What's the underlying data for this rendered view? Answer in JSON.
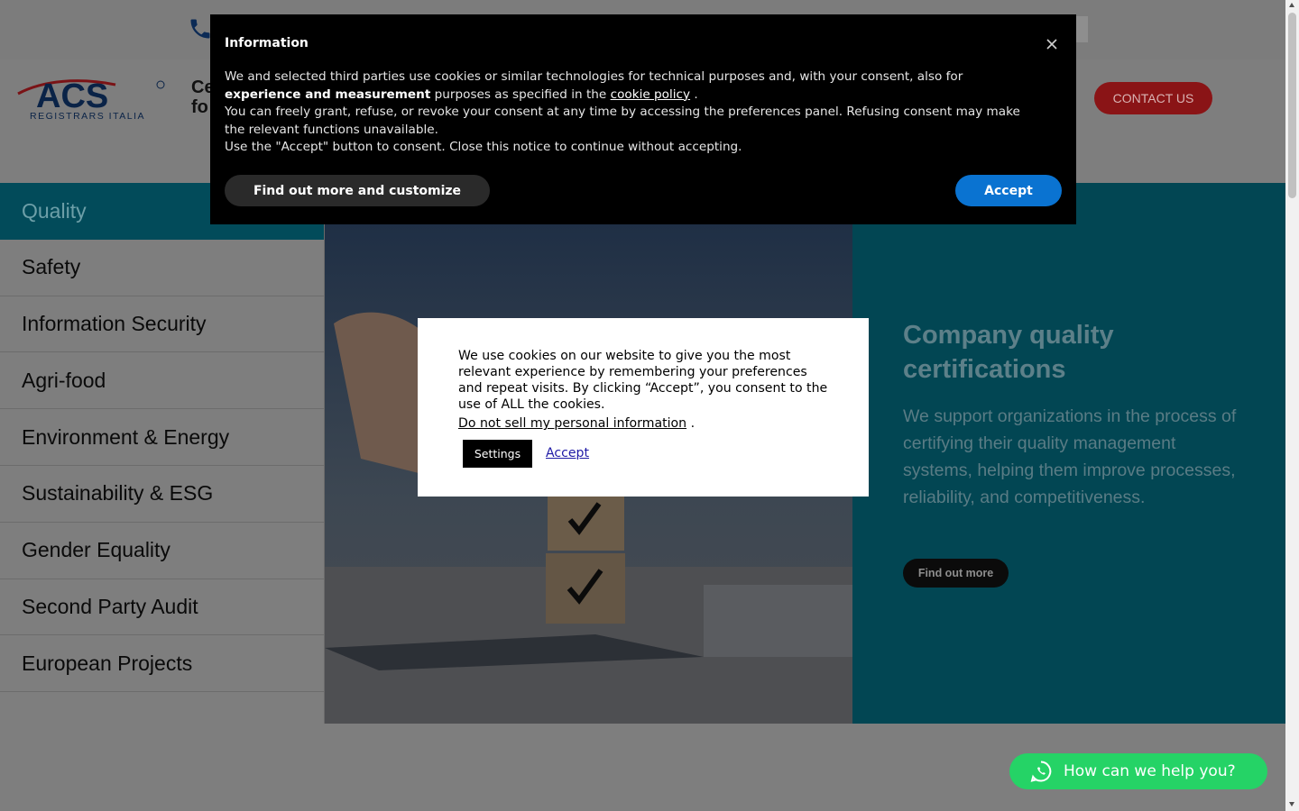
{
  "header": {
    "logo_text": "ACS",
    "logo_subtext": "REGISTRARS ITALIA",
    "tagline": "Ce fo",
    "contact_label": "CONTACT US"
  },
  "sidebar": {
    "items": [
      {
        "label": "Quality",
        "active": true
      },
      {
        "label": "Safety"
      },
      {
        "label": "Information Security"
      },
      {
        "label": "Agri-food"
      },
      {
        "label": "Environment & Energy"
      },
      {
        "label": "Sustainability & ESG"
      },
      {
        "label": "Gender Equality"
      },
      {
        "label": "Second Party Audit"
      },
      {
        "label": "European Projects"
      }
    ]
  },
  "hero": {
    "title": "Company quality certifications",
    "description": "We support organizations in the process of certifying their quality management systems, helping them improve processes, reliability, and competitiveness.",
    "button_label": "Find out more"
  },
  "info_banner": {
    "title": "Information",
    "line1_pre": "We and selected third parties use cookies or similar technologies for technical purposes and, with your consent, also for",
    "line1_bold": "experience and measurement",
    "line1_post": "purposes as specified in the",
    "policy_link": "cookie policy",
    "line1_end": ".",
    "line2": "You can freely grant, refuse, or revoke your consent at any time by accessing the preferences panel. Refusing consent may make the relevant functions unavailable.",
    "line3": "Use the \"Accept\" button to consent. Close this notice to continue without accepting.",
    "customize_label": "Find out more and customize",
    "accept_label": "Accept"
  },
  "cookie_box": {
    "text": "We use cookies on our website to give you the most relevant experience by remembering your preferences and repeat visits. By clicking “Accept”, you consent to the use of ALL the cookies.",
    "dns_link": "Do not sell my personal information",
    "dns_end": ".",
    "settings_label": "Settings",
    "accept_label": "Accept"
  },
  "whatsapp": {
    "label": "How can we help you?"
  },
  "colors": {
    "teal": "#024653",
    "accept_blue": "#0a73d1",
    "contact_red": "#8a1416",
    "whatsapp_green": "#25d366"
  }
}
